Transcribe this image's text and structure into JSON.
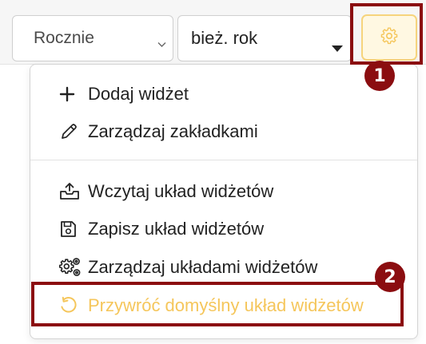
{
  "toolbar": {
    "period_select": {
      "value": "Rocznie"
    },
    "year_select": {
      "value": "bież. rok"
    }
  },
  "annotations": {
    "badge_1": "1",
    "badge_2": "2"
  },
  "menu": {
    "items": [
      {
        "label": "Dodaj widżet",
        "icon": "plus-icon"
      },
      {
        "label": "Zarządzaj zakładkami",
        "icon": "pencil-icon"
      },
      {
        "label": "Wczytaj układ widżetów",
        "icon": "upload-tray-icon"
      },
      {
        "label": "Zapisz układ widżetów",
        "icon": "save-disk-icon"
      },
      {
        "label": "Zarządzaj układami widżetów",
        "icon": "gears-icon"
      },
      {
        "label": "Przywróć domyślny układ widżetów",
        "icon": "restore-icon"
      }
    ]
  },
  "colors": {
    "accent": "#f5c65b",
    "annotation": "#8b0d10",
    "text": "#222222"
  }
}
